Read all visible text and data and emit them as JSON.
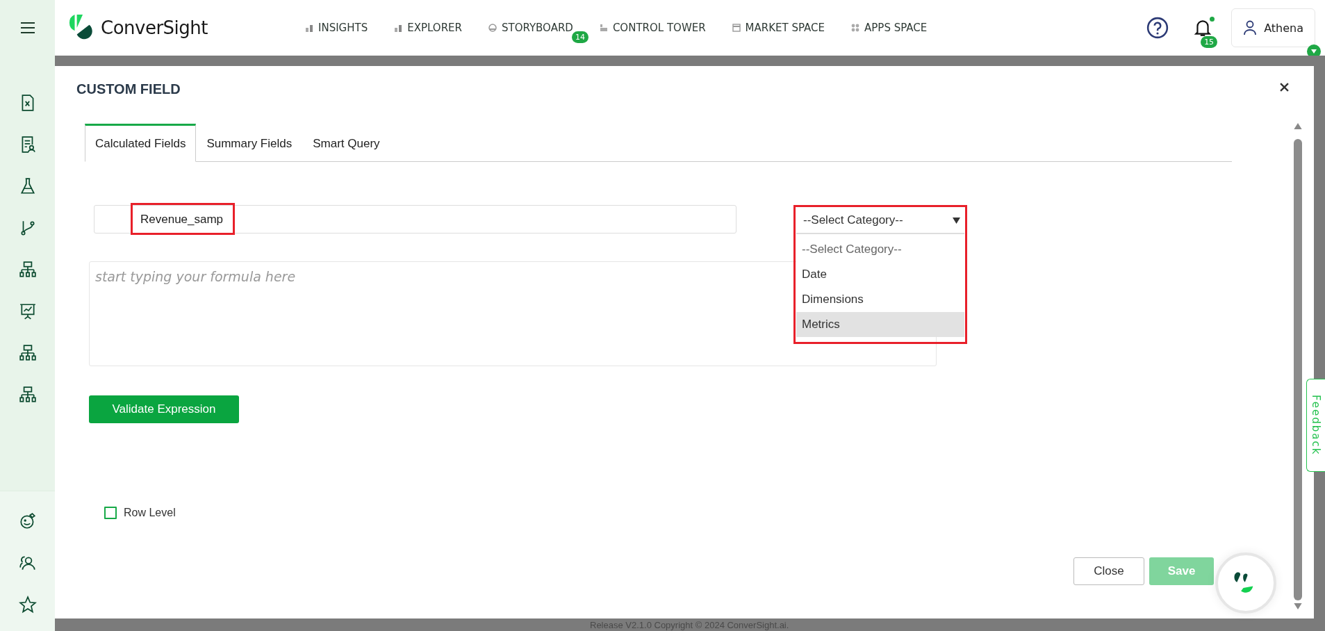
{
  "topbar": {
    "logo": "ConverSight",
    "nav": [
      {
        "label": "INSIGHTS",
        "kind": "bars"
      },
      {
        "label": "EXPLORER",
        "kind": "bars"
      },
      {
        "label": "STORYBOARD",
        "kind": "gauge",
        "badge": "14"
      },
      {
        "label": "CONTROL TOWER",
        "kind": "tower"
      },
      {
        "label": "MARKET SPACE",
        "kind": "store"
      },
      {
        "label": "APPS SPACE",
        "kind": "dots"
      }
    ],
    "notifications": {
      "badge": "15",
      "unread": true
    },
    "user": {
      "name": "Athena"
    }
  },
  "dialog": {
    "title": "CUSTOM FIELD",
    "tabs": [
      {
        "label": "Calculated Fields",
        "selected": true
      },
      {
        "label": "Summary Fields",
        "selected": false
      },
      {
        "label": "Smart Query",
        "selected": false
      }
    ],
    "name_field": {
      "value": "Revenue_samp",
      "annotated": true
    },
    "category_select": {
      "value": "--Select Category--",
      "expanded": true,
      "annotated": true,
      "options": [
        {
          "label": "--Select Category--",
          "kind": "placeholder",
          "highlighted": false
        },
        {
          "label": "Date",
          "kind": "option",
          "highlighted": false
        },
        {
          "label": "Dimensions",
          "kind": "option",
          "highlighted": false
        },
        {
          "label": "Metrics",
          "kind": "option",
          "highlighted": true
        }
      ]
    },
    "formula": {
      "placeholder": "start typing your formula here"
    },
    "validate_button": "Validate Expression",
    "row_level": {
      "label": "Row Level",
      "checked": false
    },
    "close_button": {
      "label": "Close",
      "disabled": false
    },
    "save_button": {
      "label": "Save",
      "disabled": true
    }
  },
  "feedback_tab": "Feedback",
  "footer": "Release V2.1.0 Copyright © 2024 ConverSight.ai."
}
